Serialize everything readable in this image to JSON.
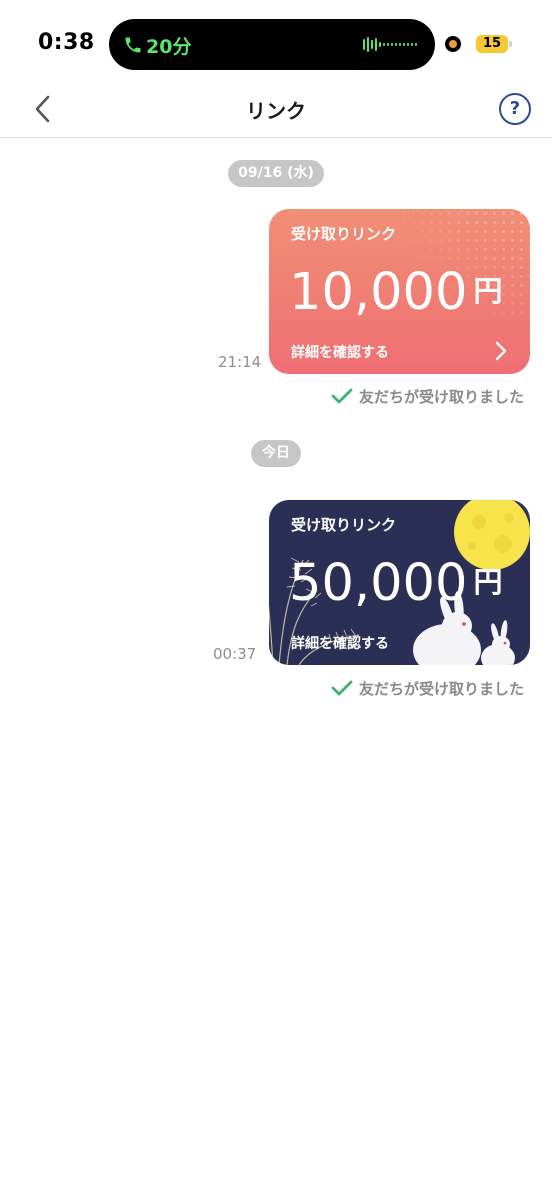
{
  "status_bar": {
    "time": "0:38",
    "call_duration": "20分",
    "battery_level": "15"
  },
  "nav": {
    "title": "リンク",
    "back_icon": "chevron-left-icon",
    "help_icon": "question-icon",
    "help_glyph": "?"
  },
  "sections": [
    {
      "date": "09/16 (水)",
      "card": {
        "label": "受け取りリンク",
        "amount": "10,000",
        "currency": "円",
        "detail": "詳細を確認する",
        "theme": "coral-gradient"
      },
      "time": "21:14",
      "receipt": "友だちが受け取りました"
    },
    {
      "date": "今日",
      "card": {
        "label": "受け取りリンク",
        "amount": "50,000",
        "currency": "円",
        "detail": "詳細を確認する",
        "theme": "moon-rabbit-night"
      },
      "time": "00:37",
      "receipt": "友だちが受け取りました"
    }
  ],
  "colors": {
    "accent_green": "#5ce36b",
    "check_green": "#3cb371",
    "help_blue": "#2d4d8f",
    "card1_top": "#f18f75",
    "card1_bottom": "#ef6f74",
    "card2_bg": "#2b2f55",
    "moon": "#f7e34c"
  }
}
